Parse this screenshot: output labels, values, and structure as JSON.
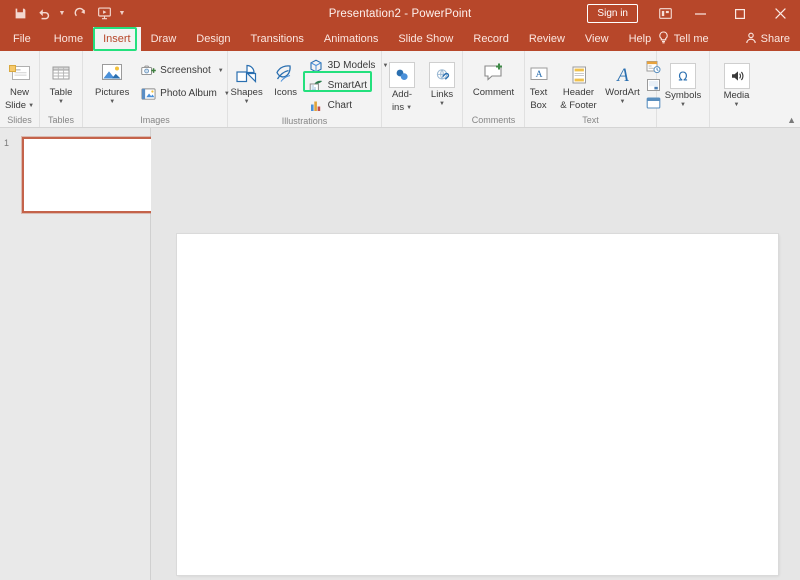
{
  "window": {
    "title": "Presentation2  -  PowerPoint",
    "sign_in_label": "Sign in",
    "ribbon_display_options_icon": "ribbon-display-options-icon",
    "minimize_icon": "minimize-icon",
    "maximize_icon": "maximize-icon",
    "close_icon": "close-icon"
  },
  "quick_access": {
    "items": [
      {
        "name": "save-icon",
        "label": "Save"
      },
      {
        "name": "undo-icon",
        "label": "Undo"
      },
      {
        "name": "redo-icon",
        "label": "Redo"
      },
      {
        "name": "start-from-beginning-icon",
        "label": "Start From Beginning"
      },
      {
        "name": "customize-quick-access-toolbar-icon",
        "label": "Customize Quick Access Toolbar"
      }
    ]
  },
  "tabs": [
    {
      "label": "File",
      "active": false
    },
    {
      "label": "Home",
      "active": false
    },
    {
      "label": "Insert",
      "active": true
    },
    {
      "label": "Draw",
      "active": false
    },
    {
      "label": "Design",
      "active": false
    },
    {
      "label": "Transitions",
      "active": false
    },
    {
      "label": "Animations",
      "active": false
    },
    {
      "label": "Slide Show",
      "active": false
    },
    {
      "label": "Record",
      "active": false
    },
    {
      "label": "Review",
      "active": false
    },
    {
      "label": "View",
      "active": false
    },
    {
      "label": "Help",
      "active": false
    }
  ],
  "tabstrip_right": {
    "tell_me_label": "Tell me",
    "tell_me_icon": "lightbulb-icon",
    "share_label": "Share",
    "share_icon": "person-share-icon"
  },
  "ribbon": {
    "collapse_icon": "chevron-up-icon",
    "groups": [
      {
        "label": "Slides",
        "buttons": [
          {
            "name": "new-slide-button",
            "label": "New\nSlide",
            "icon": "new-slide-icon",
            "caret": true
          }
        ]
      },
      {
        "label": "Tables",
        "buttons": [
          {
            "name": "table-button",
            "label": "Table",
            "icon": "table-icon",
            "caret": true
          }
        ]
      },
      {
        "label": "Images",
        "buttons": [
          {
            "name": "pictures-button",
            "label": "Pictures",
            "icon": "pictures-icon",
            "caret": true
          },
          {
            "name": "screenshot-button",
            "label": "Screenshot",
            "icon": "screenshot-icon",
            "caret": true
          },
          {
            "name": "photo-album-button",
            "label": "Photo Album",
            "icon": "photo-album-icon",
            "caret": true
          }
        ]
      },
      {
        "label": "Illustrations",
        "buttons": [
          {
            "name": "shapes-button",
            "label": "Shapes",
            "icon": "shapes-icon",
            "caret": true
          },
          {
            "name": "icons-button",
            "label": "Icons",
            "icon": "icons-icon",
            "caret": false
          },
          {
            "name": "3d-models-button",
            "label": "3D Models",
            "icon": "3d-models-icon",
            "caret": true
          },
          {
            "name": "smartart-button",
            "label": "SmartArt",
            "icon": "smartart-icon",
            "caret": false,
            "highlighted": true
          },
          {
            "name": "chart-button",
            "label": "Chart",
            "icon": "chart-icon",
            "caret": false
          }
        ]
      },
      {
        "label": "",
        "buttons": [
          {
            "name": "add-ins-button",
            "label": "Add-\nins",
            "icon": "add-ins-icon",
            "caret": true
          },
          {
            "name": "links-button",
            "label": "Links",
            "icon": "links-icon",
            "caret": true
          }
        ]
      },
      {
        "label": "Comments",
        "buttons": [
          {
            "name": "comment-button",
            "label": "Comment",
            "icon": "comment-icon",
            "caret": false
          }
        ]
      },
      {
        "label": "Text",
        "buttons": [
          {
            "name": "text-box-button",
            "label": "Text\nBox",
            "icon": "text-box-icon",
            "caret": false
          },
          {
            "name": "header-footer-button",
            "label": "Header\n& Footer",
            "icon": "header-footer-icon",
            "caret": false
          },
          {
            "name": "wordart-button",
            "label": "WordArt",
            "icon": "wordart-icon",
            "caret": true
          },
          {
            "name": "date-time-button",
            "label": "",
            "icon": "date-time-icon",
            "caret": false
          },
          {
            "name": "slide-number-button",
            "label": "",
            "icon": "slide-number-icon",
            "caret": false
          },
          {
            "name": "object-button",
            "label": "",
            "icon": "object-icon",
            "caret": false
          }
        ]
      },
      {
        "label": "",
        "buttons": [
          {
            "name": "symbols-button",
            "label": "Symbols",
            "icon": "omega-icon",
            "caret": true
          }
        ]
      },
      {
        "label": "",
        "buttons": [
          {
            "name": "media-button",
            "label": "Media",
            "icon": "media-speaker-icon",
            "caret": true
          }
        ]
      }
    ],
    "labels": {
      "slides": "Slides",
      "tables": "Tables",
      "images": "Images",
      "illustrations": "Illustrations",
      "comments": "Comments",
      "text": "Text"
    },
    "button_labels": {
      "new_slide_line1": "New",
      "new_slide_line2": "Slide",
      "table": "Table",
      "pictures": "Pictures",
      "screenshot": "Screenshot",
      "photo_album": "Photo Album",
      "shapes": "Shapes",
      "icons": "Icons",
      "models_3d": "3D Models",
      "smartart": "SmartArt",
      "chart": "Chart",
      "addins_line1": "Add-",
      "addins_line2": "ins",
      "links": "Links",
      "comment": "Comment",
      "textbox_line1": "Text",
      "textbox_line2": "Box",
      "header_line1": "Header",
      "header_line2": "& Footer",
      "wordart": "WordArt",
      "symbols": "Symbols",
      "media": "Media"
    }
  },
  "thumbnails": {
    "slides": [
      {
        "number": "1",
        "selected": true
      }
    ]
  },
  "colors": {
    "brand": "#b7472a",
    "highlight": "#24e07d",
    "ribbon_bg": "#f3f3f3",
    "workspace_bg": "#e6e6e6",
    "slide_selected_border": "#c4634a"
  }
}
